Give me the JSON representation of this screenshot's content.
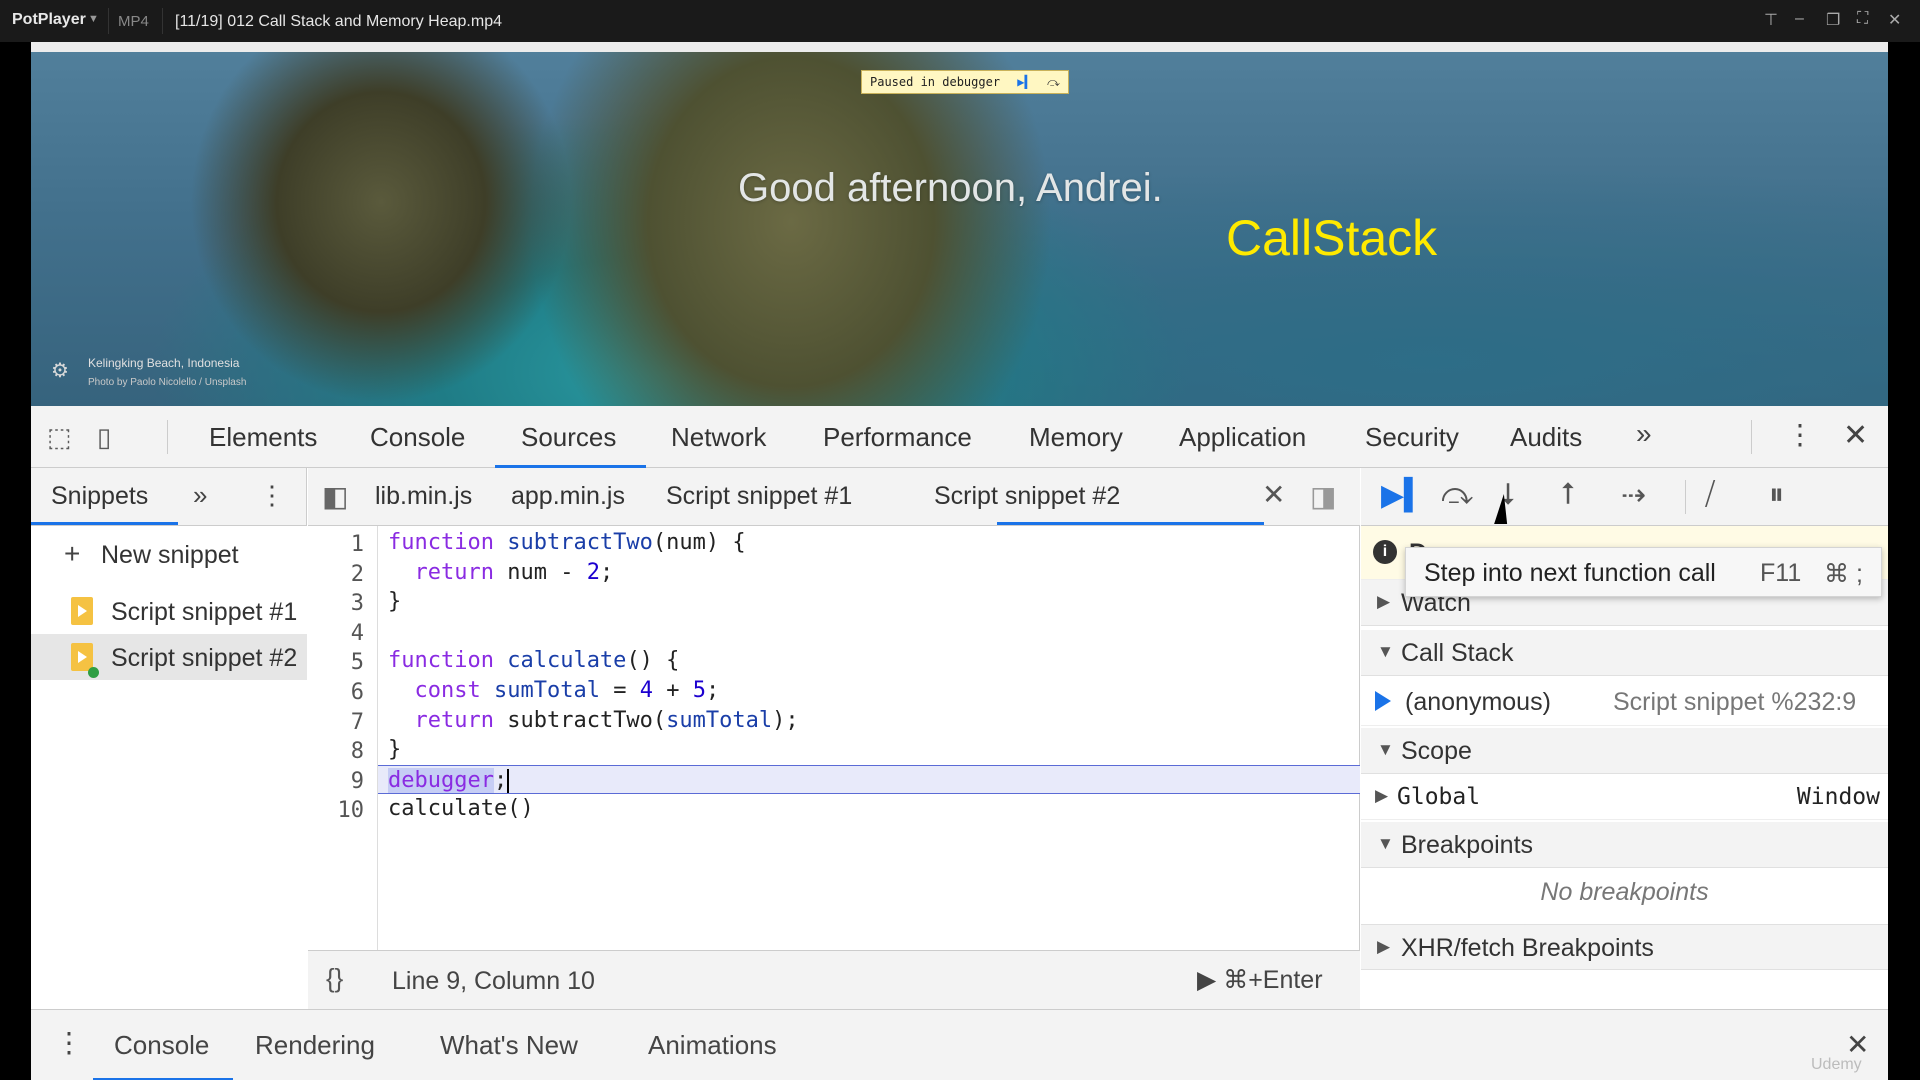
{
  "player": {
    "brand": "PotPlayer",
    "format": "MP4",
    "title": "[11/19] 012 Call Stack and Memory Heap.mp4"
  },
  "page": {
    "debug_pill": "Paused in debugger",
    "greeting": "Good afternoon, Andrei.",
    "overlay_label": "CallStack",
    "photo_location": "Kelingking Beach, Indonesia",
    "photo_credit": "Photo by Paolo Nicolello / Unsplash"
  },
  "devtools": {
    "tabs": [
      "Elements",
      "Console",
      "Sources",
      "Network",
      "Performance",
      "Memory",
      "Application",
      "Security",
      "Audits"
    ],
    "active_tab": "Sources"
  },
  "navigator": {
    "title": "Snippets",
    "new_snippet": "New snippet",
    "items": [
      "Script snippet #1",
      "Script snippet #2"
    ]
  },
  "editor": {
    "tabs": [
      "lib.min.js",
      "app.min.js",
      "Script snippet #1",
      "Script snippet #2"
    ],
    "active_tab": "Script snippet #2",
    "line_numbers": [
      "1",
      "2",
      "3",
      "4",
      "5",
      "6",
      "7",
      "8",
      "9",
      "10"
    ],
    "status": "Line 9, Column 10",
    "run_hint": "⌘+Enter"
  },
  "debugger": {
    "message_partial": "De",
    "tooltip": {
      "text": "Step into next function call",
      "key": "F11",
      "mac_key": "⌘ ;"
    },
    "sections": {
      "watch": "Watch",
      "call_stack": "Call Stack",
      "scope": "Scope",
      "breakpoints": "Breakpoints",
      "xhr": "XHR/fetch Breakpoints"
    },
    "call_stack": {
      "function": "(anonymous)",
      "location": "Script snippet %232:9"
    },
    "scope": {
      "name": "Global",
      "value": "Window"
    },
    "no_breakpoints": "No breakpoints"
  },
  "drawer": {
    "tabs": [
      "Console",
      "Rendering",
      "What's New",
      "Animations"
    ],
    "active_tab": "Console",
    "watermark": "Udemy"
  },
  "colors": {
    "accent": "#1a73e8",
    "overlay_label": "#ffea00",
    "paused_line": "#e8eafa",
    "keyword": "#8a2be2",
    "function": "#1a3ea8",
    "number": "#1c00cf"
  }
}
